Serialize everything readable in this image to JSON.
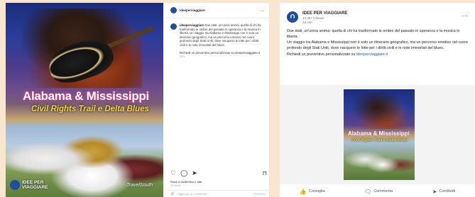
{
  "instagram": {
    "username": "ideeperviaggiare",
    "more_icon": "…",
    "caption_user": "ideeperviaggiare",
    "caption": "Due stati, un'unica anima: quella di chi ha trasformato le ombre del passato in speranza e la musica in libertà. Un viaggio tra Alabama e Mississippi non è solo un itinerario geografico, ma un percorso emotivo nel cuore profondo degli Stati Uniti, dove nacquero le lotte per i diritti civili e le note immortali del blues.",
    "cta": "Richiedi un preventivo personalizzato su ideeperviaggiare.it",
    "caption_time": "23 h",
    "photo_title": "Alabama & Mississippi",
    "photo_subtitle": "Civil Rights Trail e Delta Blues",
    "logo_text_1": "IDEE PER",
    "logo_text_2": "VIAGGIARE",
    "partner_logo": "TravelSouth",
    "likes": "Piace a idv&ferlino e altri",
    "date": "23 ore fa",
    "comment_placeholder": "Aggiungi un commento...",
    "publish_label": "Pubblica"
  },
  "linkedin": {
    "page_name": "IDEE PER VIAGGIARE",
    "followers": "14.367 follower",
    "time": "1d min",
    "more_icon": "…",
    "body_1": "Due stati, un'unica anima: quella di chi ha trasformato le ombre del passato in speranza e la musica in libertà.",
    "body_2": "Un viaggio tra Alabama e Mississippi non è solo un itinerario geografico, ma un percorso emotivo nel cuore profondo degli Stati Uniti, dove nacquero le lotte per i diritti civili e le note immortali del blues.",
    "cta_text": "Richiedi un preventivo personalizzato su ",
    "cta_link": "ideeperviaggiare.it",
    "image_title": "Alabama & Mississippi",
    "image_subtitle": "Civil Rights Trail e Delta Blues",
    "actions": [
      {
        "label": "Consiglia",
        "icon": "thumbs-up-icon"
      },
      {
        "label": "Commenta",
        "icon": "comment-icon"
      },
      {
        "label": "Condividi",
        "icon": "send-icon"
      }
    ]
  },
  "colors": {
    "background": "#f8e6cf",
    "brand_blue": "#1d4f9c",
    "title_pink": "#e04a8e",
    "subtitle_yellow": "#f5d33a",
    "link_blue": "#0a66c2"
  }
}
